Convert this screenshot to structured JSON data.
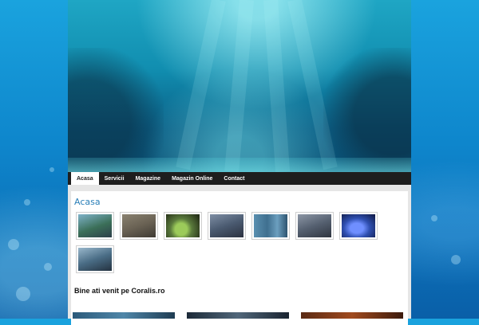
{
  "nav": {
    "items": [
      {
        "label": "Acasa",
        "active": true
      },
      {
        "label": "Servicii",
        "active": false
      },
      {
        "label": "Magazine",
        "active": false
      },
      {
        "label": "Magazin Online",
        "active": false
      },
      {
        "label": "Contact",
        "active": false
      }
    ]
  },
  "main": {
    "heading": "Acasa",
    "welcome": "Bine ati venit pe Coralis.ro",
    "gallery": [
      {
        "icon": "aquarium-photo-icon",
        "color": "#3b6f58"
      },
      {
        "icon": "store-shelves-photo-icon",
        "color": "#6a6254"
      },
      {
        "icon": "coral-tank-photo-icon",
        "color": "#5a7a3c"
      },
      {
        "icon": "shop-interior-photo-icon",
        "color": "#4a5a70"
      },
      {
        "icon": "aquarium-row-photo-icon",
        "color": "#3f6f8f"
      },
      {
        "icon": "shop-counter-photo-icon",
        "color": "#556070"
      },
      {
        "icon": "blue-coral-photo-icon",
        "color": "#2f4fb0"
      },
      {
        "icon": "tank-display-photo-icon",
        "color": "#4a6d86"
      }
    ]
  },
  "colors": {
    "accent": "#2a7fb8",
    "nav_bg": "#1e1e1e"
  }
}
